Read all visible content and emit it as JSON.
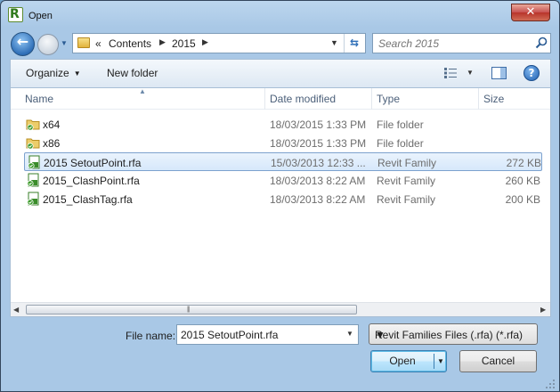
{
  "window": {
    "title": "Open",
    "app_icon_letter": "R"
  },
  "navigation": {
    "back_label": "←",
    "path_overflow": "«",
    "path": [
      "Contents",
      "2015"
    ],
    "search_placeholder": "Search 2015"
  },
  "toolbar": {
    "organize_label": "Organize",
    "new_folder_label": "New folder"
  },
  "columns": {
    "name": "Name",
    "date": "Date modified",
    "type": "Type",
    "size": "Size"
  },
  "files": [
    {
      "name": "x64",
      "date": "18/03/2015 1:33 PM",
      "type": "File folder",
      "size": "",
      "icon": "folder-icon",
      "selected": false
    },
    {
      "name": "x86",
      "date": "18/03/2015 1:33 PM",
      "type": "File folder",
      "size": "",
      "icon": "folder-icon",
      "selected": false
    },
    {
      "name": "2015 SetoutPoint.rfa",
      "date": "15/03/2013 12:33 ...",
      "type": "Revit Family",
      "size": "272 KB",
      "icon": "revit-family-icon",
      "selected": true
    },
    {
      "name": "2015_ClashPoint.rfa",
      "date": "18/03/2013 8:22 AM",
      "type": "Revit Family",
      "size": "260 KB",
      "icon": "revit-family-icon",
      "selected": false
    },
    {
      "name": "2015_ClashTag.rfa",
      "date": "18/03/2013 8:22 AM",
      "type": "Revit Family",
      "size": "200 KB",
      "icon": "revit-family-icon",
      "selected": false
    }
  ],
  "bottom": {
    "file_name_label": "File name:",
    "file_name_value": "2015 SetoutPoint.rfa",
    "filter_value": "Revit Families Files (.rfa) (*.rfa)",
    "open_label": "Open",
    "cancel_label": "Cancel"
  },
  "colors": {
    "accent": "#2f6fb8",
    "selection": "#d6e8fb",
    "revit_green": "#2f7a1c"
  }
}
